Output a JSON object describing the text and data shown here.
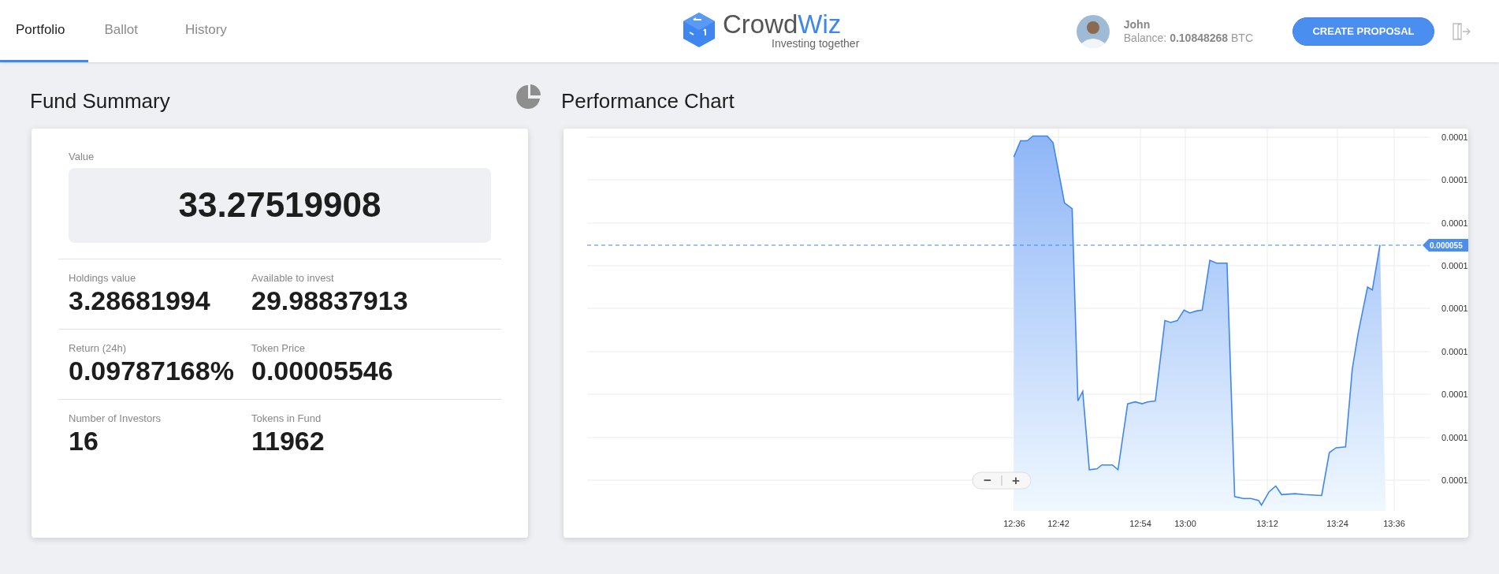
{
  "tabs": [
    {
      "label": "Portfolio",
      "selected": true
    },
    {
      "label": "Ballot",
      "selected": false
    },
    {
      "label": "History",
      "selected": false
    }
  ],
  "logo": {
    "name_part_1": "Crowd",
    "name_part_2": "Wiz",
    "tagline": "Investing together"
  },
  "user": {
    "name": "John",
    "balance_label": "Balance:",
    "balance": "0.10848268",
    "currency": "BTC"
  },
  "create_button": "CREATE PROPOSAL",
  "fund_summary": {
    "title": "Fund Summary",
    "value_label": "Value",
    "value": "33.27519908",
    "stats": [
      {
        "label": "Holdings value",
        "value": "3.28681994"
      },
      {
        "label": "Available to invest",
        "value": "29.98837913"
      },
      {
        "label": "Return (24h)",
        "value": "0.09787168%"
      },
      {
        "label": "Token Price",
        "value": "0.00005546"
      },
      {
        "label": "Number of Investors",
        "value": "16"
      },
      {
        "label": "Tokens in Fund",
        "value": "11962"
      }
    ]
  },
  "performance_chart": {
    "title": "Performance Chart",
    "y_axis_labels": [
      "0.0001",
      "0.0001",
      "0.0001",
      "0.0001",
      "0.0001",
      "0.0001",
      "0.0001",
      "0.0001",
      "0.0001"
    ],
    "current_price": "0.000055",
    "x_axis_labels": [
      "12:36",
      "12:42",
      "12:54",
      "13:00",
      "13:12",
      "13:24",
      "13:36"
    ],
    "zoom_out": "−",
    "zoom_in": "+"
  }
}
